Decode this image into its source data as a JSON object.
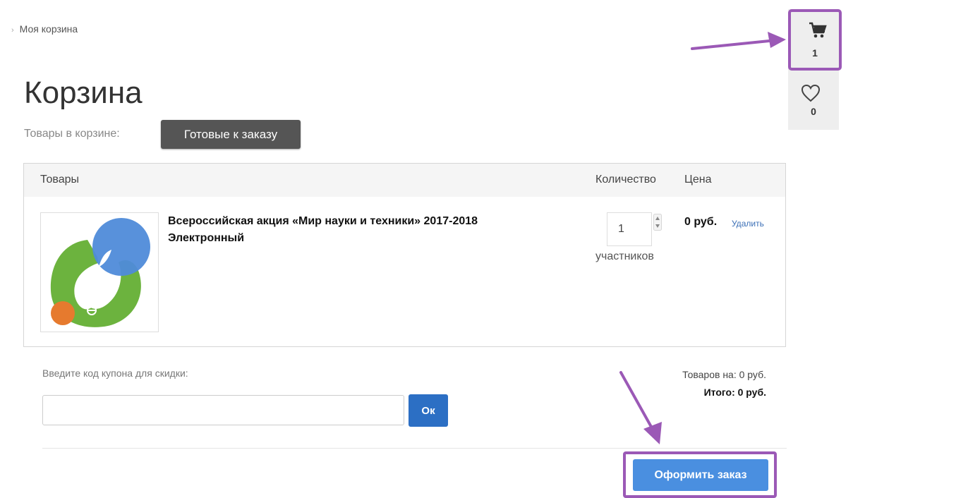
{
  "breadcrumb": {
    "separator": "›",
    "current": "Моя корзина"
  },
  "page": {
    "title": "Корзина"
  },
  "cart_tabs": {
    "label": "Товары в корзине:",
    "ready_button": "Готовые к заказу"
  },
  "table": {
    "headers": {
      "goods": "Товары",
      "quantity": "Количество",
      "price": "Цена"
    },
    "rows": [
      {
        "name_line1": "Всероссийская акция «Мир науки и техники» 2017-2018",
        "name_line2": "Электронный",
        "quantity": "1",
        "unit": "участников",
        "price": "0 руб.",
        "delete_label": "Удалить"
      }
    ]
  },
  "coupon": {
    "label": "Введите код купона для скидки:",
    "value": "",
    "ok_label": "Ок"
  },
  "totals": {
    "goods_label": "Товаров на:",
    "goods_value": "0 руб.",
    "total_label": "Итого:",
    "total_value": "0 руб."
  },
  "checkout": {
    "button_label": "Оформить заказ"
  },
  "widgets": {
    "cart_count": "1",
    "favorites_count": "0"
  },
  "colors": {
    "accent_blue": "#4a8fe0",
    "ok_blue": "#2c6fc4",
    "highlight_purple": "#9b59b6",
    "dark_button": "#555555"
  },
  "icons": {
    "cart": "cart-icon",
    "favorites": "heart-icon"
  }
}
